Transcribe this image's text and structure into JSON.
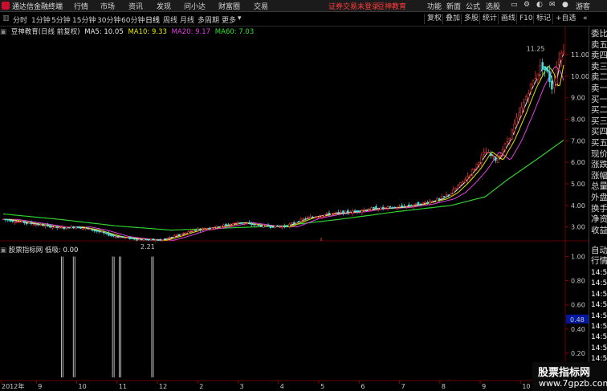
{
  "app": {
    "title": "通达信金融终端",
    "menu": [
      "行情",
      "市场",
      "资讯",
      "发现",
      "问小达",
      "财富圈",
      "交易"
    ],
    "notice": [
      "证券交易未登录",
      "豆神教育"
    ],
    "right_menu": [
      "功能",
      "新面",
      "公式",
      "选股"
    ],
    "guest": "游客"
  },
  "toolbar": {
    "periods": [
      "分时",
      "1分钟",
      "5分钟",
      "15分钟",
      "30分钟",
      "60分钟",
      "日线",
      "周线",
      "月线",
      "多周期",
      "更多"
    ],
    "active_period": "日线",
    "buttons": [
      "复权",
      "叠加",
      "多股",
      "统计",
      "画线",
      "F10",
      "标记",
      "+自选"
    ]
  },
  "chart_header": {
    "stock": "豆神教育(日线 前复权)",
    "ma": [
      {
        "label": "MA5: 10.05",
        "color": "#e6e6e6"
      },
      {
        "label": "MA10: 9.33",
        "color": "#e6e600"
      },
      {
        "label": "MA20: 9.17",
        "color": "#e040e0"
      },
      {
        "label": "MA60: 7.03",
        "color": "#30e030"
      }
    ]
  },
  "indicator_header": {
    "name": "股票指标网",
    "value": "低吸: 0.00"
  },
  "side_labels": [
    "委比",
    "卖五",
    "卖四",
    "卖三",
    "卖二",
    "卖一",
    "买一",
    "买二",
    "买三",
    "买四",
    "买五",
    "现价",
    "涨跌",
    "涨幅",
    "总量",
    "外盘",
    "换手",
    "净资",
    "收益"
  ],
  "side_lower": {
    "title_1": "自动",
    "title_2": "行情",
    "times": [
      "14:50",
      "14:50",
      "14:50",
      "14:50",
      "14:50",
      "14:50",
      "14:50",
      "14:50",
      "14:50",
      "14:50",
      "14:50"
    ]
  },
  "watermark": {
    "line1": "股票指标网",
    "line2": "www.7gpzb.com"
  },
  "chart_data": [
    {
      "type": "candlestick",
      "title": "豆神教育(日线 前复权)",
      "y_ticks": [
        3.0,
        4.0,
        5.0,
        6.0,
        7.0,
        8.0,
        9.0,
        10.0,
        11.0
      ],
      "ylim": [
        2.5,
        11.9
      ],
      "annotations": [
        {
          "text": "11.25",
          "value": 11.25
        },
        {
          "text": "2.21",
          "value": 2.21
        }
      ],
      "price_path": [
        [
          0,
          3.35
        ],
        [
          0.05,
          3.15
        ],
        [
          0.1,
          2.95
        ],
        [
          0.13,
          3.0
        ],
        [
          0.16,
          2.85
        ],
        [
          0.2,
          2.55
        ],
        [
          0.24,
          2.42
        ],
        [
          0.28,
          2.38
        ],
        [
          0.31,
          2.6
        ],
        [
          0.34,
          2.85
        ],
        [
          0.38,
          3.0
        ],
        [
          0.42,
          3.2
        ],
        [
          0.46,
          3.05
        ],
        [
          0.5,
          3.0
        ],
        [
          0.54,
          3.4
        ],
        [
          0.58,
          3.6
        ],
        [
          0.62,
          3.7
        ],
        [
          0.66,
          3.85
        ],
        [
          0.7,
          3.9
        ],
        [
          0.74,
          4.05
        ],
        [
          0.78,
          4.3
        ],
        [
          0.8,
          4.6
        ],
        [
          0.82,
          5.1
        ],
        [
          0.84,
          5.7
        ],
        [
          0.86,
          6.5
        ],
        [
          0.88,
          6.1
        ],
        [
          0.9,
          7.0
        ],
        [
          0.92,
          8.2
        ],
        [
          0.94,
          9.5
        ],
        [
          0.96,
          10.5
        ],
        [
          0.97,
          10.2
        ],
        [
          0.98,
          9.4
        ],
        [
          0.99,
          10.8
        ],
        [
          1.0,
          11.25
        ]
      ],
      "ma60_path": [
        [
          0,
          3.6
        ],
        [
          0.1,
          3.35
        ],
        [
          0.2,
          3.05
        ],
        [
          0.3,
          2.85
        ],
        [
          0.4,
          2.95
        ],
        [
          0.5,
          3.05
        ],
        [
          0.6,
          3.35
        ],
        [
          0.7,
          3.7
        ],
        [
          0.8,
          4.0
        ],
        [
          0.86,
          4.4
        ],
        [
          0.9,
          5.2
        ],
        [
          0.95,
          6.1
        ],
        [
          1.0,
          7.03
        ]
      ]
    },
    {
      "type": "bar",
      "title": "股票指标网 低吸",
      "y_ticks": [
        0.2,
        0.4,
        0.6,
        0.8,
        1.0
      ],
      "ylim": [
        0,
        1.05
      ],
      "current": 0.48,
      "spikes_x": [
        0.104,
        0.125,
        0.195,
        0.207,
        0.265
      ],
      "x_labels": [
        "2012年",
        "9",
        "10",
        "11",
        "12",
        "2",
        "3",
        "4",
        "5",
        "6",
        "7",
        "8",
        "9",
        "10",
        "11",
        "12"
      ]
    }
  ]
}
